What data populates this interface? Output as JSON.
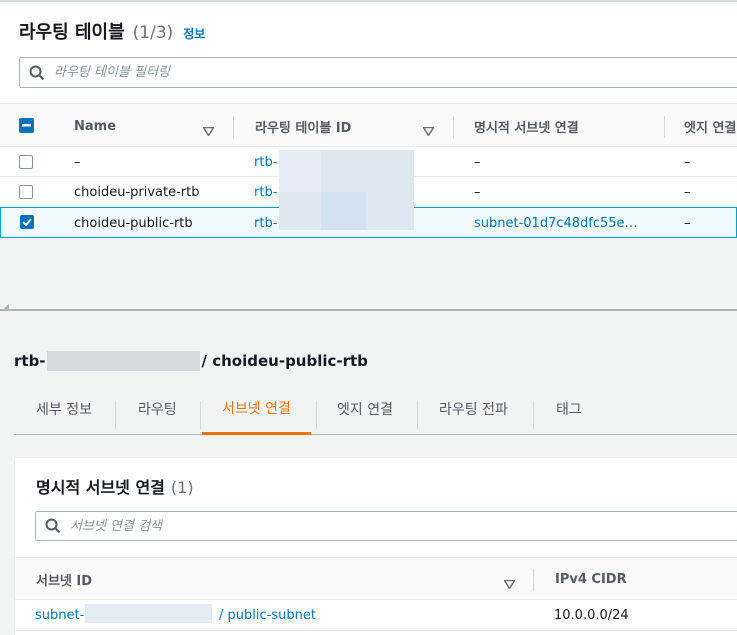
{
  "route_tables": {
    "title": "라우팅 테이블",
    "count": "(1/3)",
    "info_link": "정보",
    "filter_placeholder": "라우팅 테이블 필터링",
    "columns": [
      "Name",
      "라우팅 테이블 ID",
      "명시적 서브넷 연결",
      "엣지 연결"
    ],
    "rows": [
      {
        "name": "–",
        "id": "rtb-",
        "subnet": "–",
        "edge": "–",
        "selected": false
      },
      {
        "name": "choideu-private-rtb",
        "id": "rtb-",
        "subnet": "–",
        "edge": "–",
        "selected": false
      },
      {
        "name": "choideu-public-rtb",
        "id": "rtb-",
        "subnet": "subnet-01d7c48dfc55e…",
        "edge": "–",
        "selected": true
      }
    ]
  },
  "detail": {
    "title_prefix": "rtb-",
    "title_suffix": "/ choideu-public-rtb",
    "tabs": [
      {
        "label": "세부 정보",
        "active": false
      },
      {
        "label": "라우팅",
        "active": false
      },
      {
        "label": "서브넷 연결",
        "active": true
      },
      {
        "label": "엣지 연결",
        "active": false
      },
      {
        "label": "라우팅 전파",
        "active": false
      },
      {
        "label": "태그",
        "active": false
      }
    ]
  },
  "subnet_associations": {
    "title": "명시적 서브넷 연결",
    "count": "(1)",
    "search_placeholder": "서브넷 연결 검색",
    "columns": [
      "서브넷 ID",
      "IPv4 CIDR"
    ],
    "rows": [
      {
        "subnet_prefix": "subnet-",
        "subnet_suffix": "/ public-subnet",
        "cidr": "10.0.0.0/24"
      }
    ]
  },
  "colors": {
    "accent_orange": "#ec7211",
    "link_blue": "#0073bb",
    "selected_row_bg": "#f1faff"
  },
  "icons": [
    "search-icon",
    "sort-icon",
    "checkbox-icon",
    "scroll-left-icon"
  ]
}
